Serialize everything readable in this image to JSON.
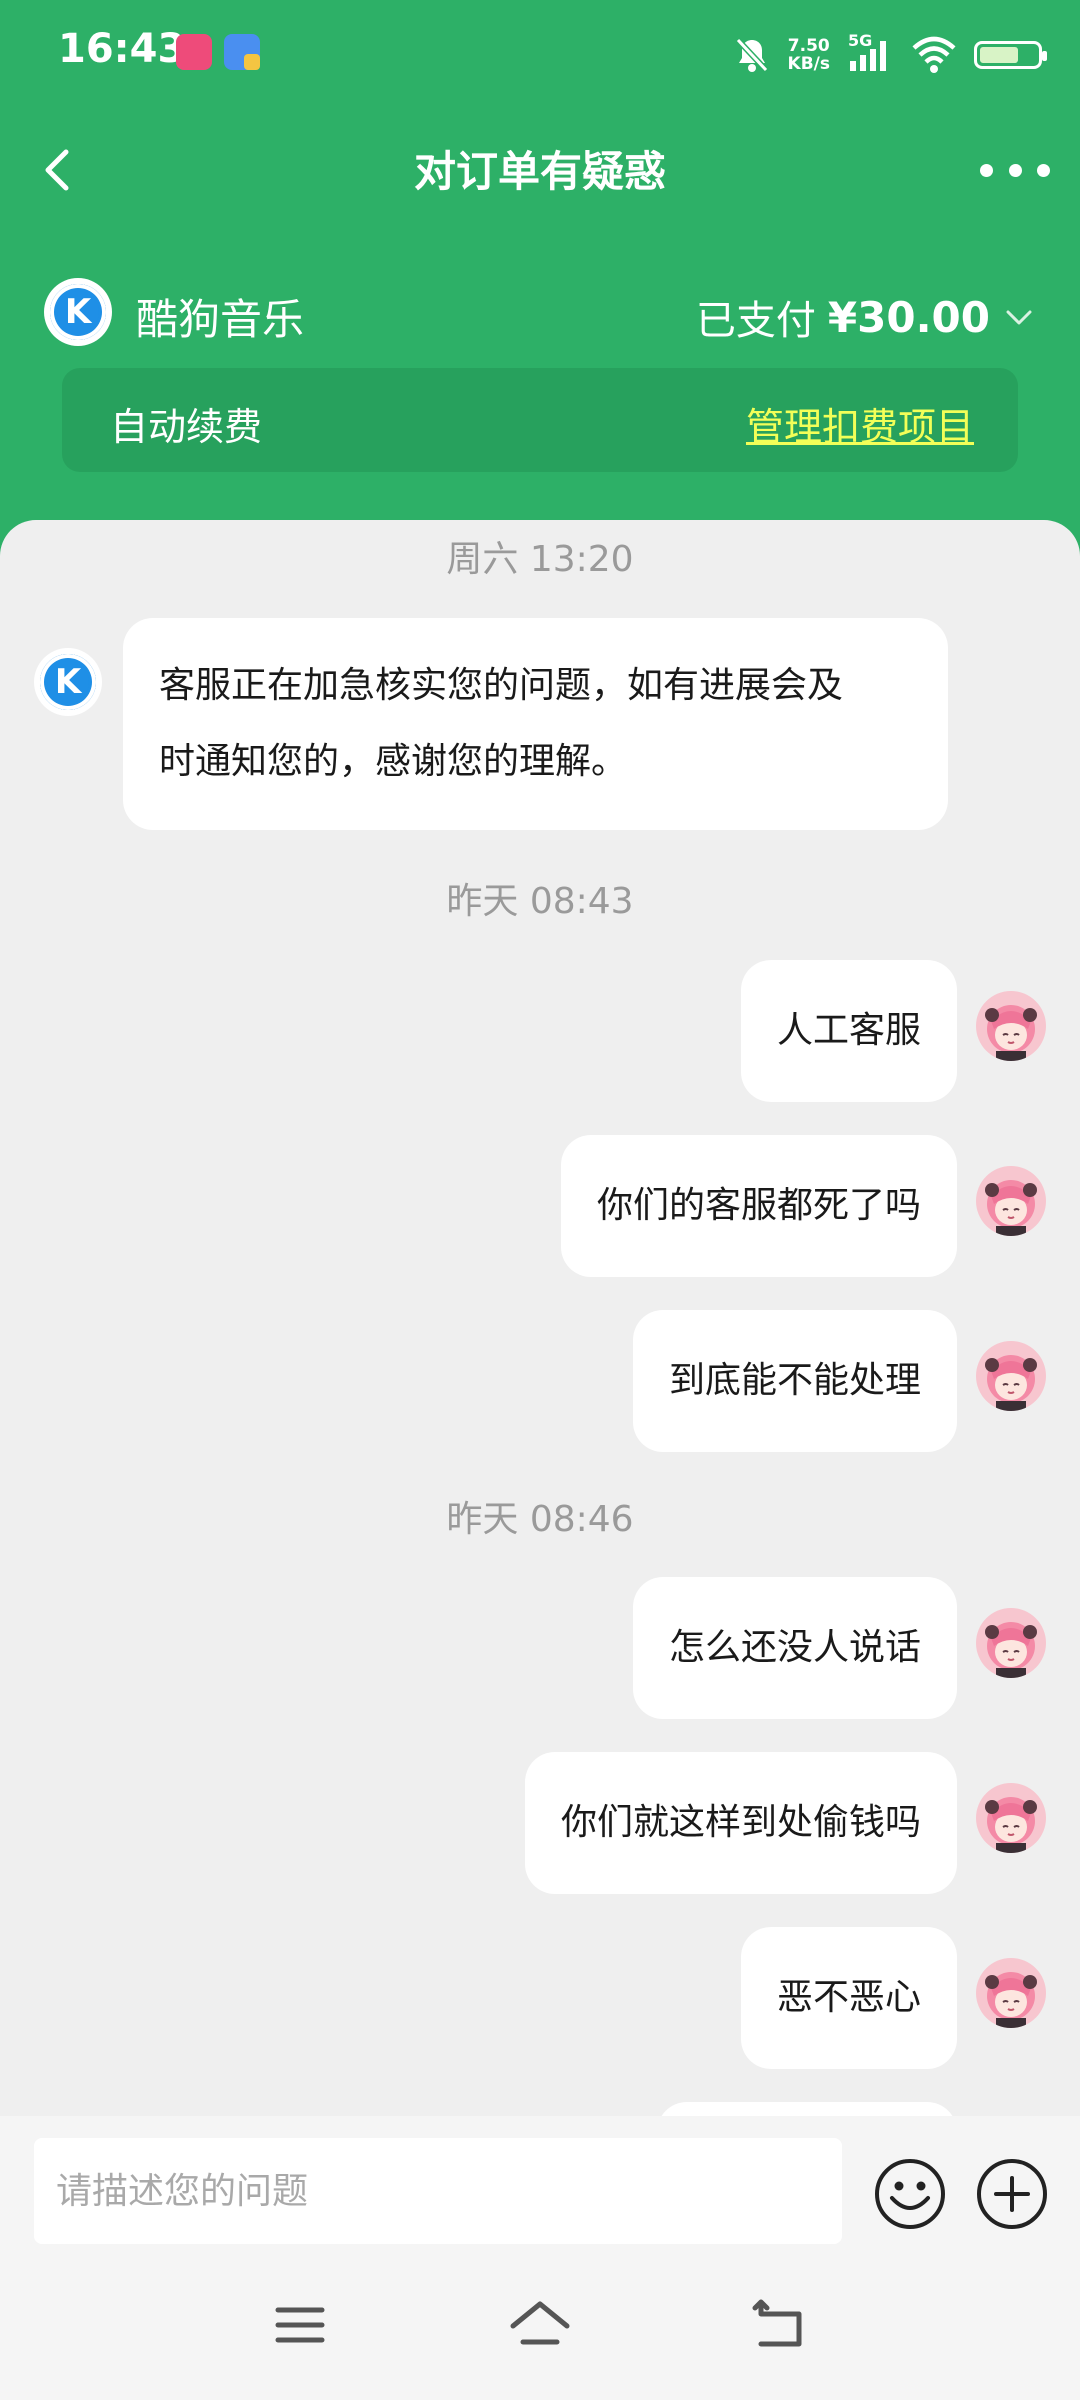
{
  "status_bar": {
    "time": "16:43",
    "net_speed_value": "7.50",
    "net_speed_unit": "KB/s",
    "network": "5G",
    "icons": [
      "app-icon-pink",
      "app-icon-blue",
      "bell-off-icon",
      "signal-icon",
      "wifi-icon",
      "battery-icon"
    ],
    "battery_level": 0.62
  },
  "header": {
    "title": "对订单有疑惑",
    "back_icon": "chevron-left-icon",
    "more_icon": "more-dots-icon"
  },
  "order": {
    "merchant_logo_letter": "K",
    "merchant_name": "酷狗音乐",
    "paid_label": "已支付",
    "paid_amount": "¥30.00",
    "expand_icon": "chevron-down-icon"
  },
  "renew": {
    "label": "自动续费",
    "link": "管理扣费项目",
    "link_color": "#f2ff58"
  },
  "chat": {
    "timestamps": [
      "周六 13:20",
      "昨天 08:43",
      "昨天 08:46"
    ],
    "service_message": {
      "avatar_letter": "K",
      "line1": "客服正在加急核实您的问题，如有进展会及",
      "line2": "时通知您的，感谢您的理解。"
    },
    "user_messages": [
      {
        "text": "人工客服"
      },
      {
        "text": "你们的客服都死了吗"
      },
      {
        "text": "到底能不能处理"
      },
      {
        "text": "怎么还没人说话"
      },
      {
        "text": "你们就这样到处偷钱吗"
      },
      {
        "text": "恶不恶心"
      }
    ]
  },
  "composer": {
    "placeholder": "请描述您的问题",
    "value": "",
    "emoji_icon": "emoji-smile-icon",
    "plus_icon": "plus-circle-icon"
  },
  "nav_bar": {
    "icons": [
      "menu-icon",
      "home-icon",
      "back-icon"
    ]
  },
  "colors": {
    "brand_green": "#2db067",
    "renew_card": "#27a15d",
    "chat_background": "#efefef",
    "bubble": "#ffffff",
    "kugou_blue": "#1f8fe6",
    "timestamp_gray": "#9a9a9a"
  }
}
